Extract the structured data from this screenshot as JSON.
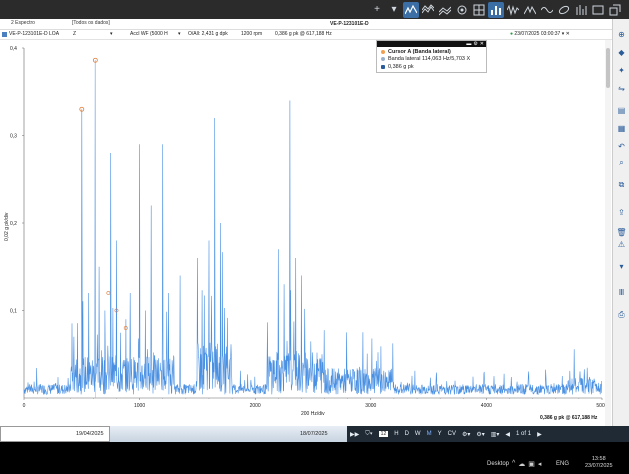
{
  "window": {
    "tabs": [
      "2 Espectro",
      "[Todos os dados]"
    ],
    "chart_title": "VE-P-123101E-D"
  },
  "info_row": {
    "asset": "VE-P-123101E-D LOA",
    "direction": "Z",
    "measurement": "Accl WF (5000 H",
    "overall": "O/All: 2,431 g dpk",
    "speed": "1200 rpm",
    "cursor_value": "0,386 g pk @ 617,188 Hz",
    "date": "23/07/2025 03:00:37"
  },
  "cursor_box": {
    "title": "Cursor A  (Banda lateral)",
    "line2": "Banda lateral  114,063 Hz/5,703 X",
    "line3": "0,386   g pk"
  },
  "chart_data": {
    "type": "line",
    "ylabel": "0,02 g pk/div",
    "xlabel": "200 Hz/div",
    "xlim": [
      0,
      3000
    ],
    "ylim": [
      0,
      0.4
    ],
    "x_ticks": [
      "0",
      "1000",
      "2000",
      "3000",
      "4000",
      "5000"
    ],
    "y_ticks": [
      "0,4",
      "0,3",
      "0,2",
      "0,1"
    ],
    "bottom_right_label": "0,386 g pk @ 617,188 Hz",
    "grid": false,
    "color": "#4a90e2",
    "peaks": [
      {
        "x": 500,
        "y": 0.33
      },
      {
        "x": 617,
        "y": 0.386
      },
      {
        "x": 750,
        "y": 0.28
      },
      {
        "x": 800,
        "y": 0.18
      },
      {
        "x": 1000,
        "y": 0.29
      },
      {
        "x": 1200,
        "y": 0.29
      },
      {
        "x": 1500,
        "y": 0.16
      },
      {
        "x": 1650,
        "y": 0.32
      },
      {
        "x": 2300,
        "y": 0.34
      },
      {
        "x": 2200,
        "y": 0.17
      }
    ]
  },
  "timeline": {
    "start_date": "19/04/2025",
    "end_date": "18/07/2025",
    "controls": [
      "H",
      "D",
      "W",
      "M",
      "Y",
      "CV"
    ],
    "count": "12",
    "page": "1 of 1"
  },
  "taskbar": {
    "desktop": "Desktop",
    "lang": "ENG",
    "time": "13:58",
    "date": "23/07/2025"
  }
}
